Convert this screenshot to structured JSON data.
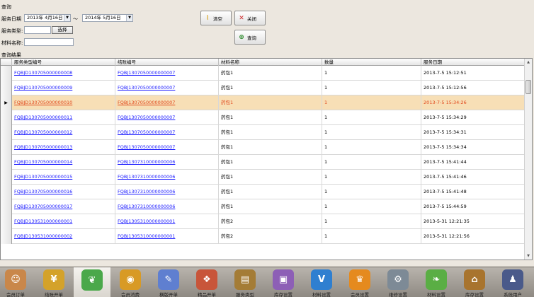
{
  "query": {
    "section_title": "查询",
    "date_label": "服务日期",
    "date_from": "2013年 4月16日",
    "date_sep": "～",
    "date_to": "2014年 5月16日",
    "service_type_label": "服务类型:",
    "service_type_value": "",
    "select_button": "选择",
    "material_label": "材料名称:",
    "material_value": "",
    "clear_button": "清空",
    "close_button": "关闭",
    "search_button": "查询"
  },
  "results": {
    "section_title": "查询结果",
    "columns": [
      "服务类型编号",
      "结账编号",
      "材料名称",
      "数量",
      "服务日期"
    ],
    "rows": [
      {
        "type_no": "FQBJD130705000000008",
        "settle_no": "FQBJ1307050000000007",
        "material": "药包1",
        "qty": "1",
        "date": "2013-7-5 15:12:51"
      },
      {
        "type_no": "FQBJD130705000000009",
        "settle_no": "FQBJ1307050000000007",
        "material": "药包1",
        "qty": "1",
        "date": "2013-7-5 15:12:56"
      },
      {
        "type_no": "FQBJD130705000000010",
        "settle_no": "FQBJ1307050000000007",
        "material": "药包1",
        "qty": "1",
        "date": "2013-7-5 15:34:26"
      },
      {
        "type_no": "FQBJD130705000000011",
        "settle_no": "FQBJ1307050000000007",
        "material": "药包1",
        "qty": "1",
        "date": "2013-7-5 15:34:29"
      },
      {
        "type_no": "FQBJD130705000000012",
        "settle_no": "FQBJ1307050000000007",
        "material": "药包1",
        "qty": "1",
        "date": "2013-7-5 15:34:31"
      },
      {
        "type_no": "FQBJD130705000000013",
        "settle_no": "FQBJ1307050000000007",
        "material": "药包1",
        "qty": "1",
        "date": "2013-7-5 15:34:34"
      },
      {
        "type_no": "FQBJD130705000000014",
        "settle_no": "FQBJ1307310000000006",
        "material": "药包1",
        "qty": "1",
        "date": "2013-7-5 15:41:44"
      },
      {
        "type_no": "FQBJD130705000000015",
        "settle_no": "FQBJ1307310000000006",
        "material": "药包1",
        "qty": "1",
        "date": "2013-7-5 15:41:46"
      },
      {
        "type_no": "FQBJD130705000000016",
        "settle_no": "FQBJ1307310000000006",
        "material": "药包1",
        "qty": "1",
        "date": "2013-7-5 15:41:48"
      },
      {
        "type_no": "FQBJD130705000000017",
        "settle_no": "FQBJ1307310000000006",
        "material": "药包1",
        "qty": "1",
        "date": "2013-7-5 15:44:59"
      },
      {
        "type_no": "FQBJD130531000000001",
        "settle_no": "FQBJ1305310000000001",
        "material": "药包2",
        "qty": "1",
        "date": "2013-5-31 12:21:35"
      },
      {
        "type_no": "FQBJD130531000000002",
        "settle_no": "FQBJ1305310000000001",
        "material": "药包2",
        "qty": "1",
        "date": "2013-5-31 12:21:56"
      }
    ],
    "selected_index": 2,
    "current_row_marker": "▶"
  },
  "dock": {
    "items": [
      {
        "label": "会员订单",
        "icon": "person-icon",
        "color": "#c9874a"
      },
      {
        "label": "结账开单",
        "icon": "money-icon",
        "color": "#d4a22a"
      },
      {
        "label": "",
        "icon": "leaf-money-icon",
        "color": "#4aa84a"
      },
      {
        "label": "会员消费",
        "icon": "coins-icon",
        "color": "#d89a25"
      },
      {
        "label": "横版开单",
        "icon": "pen-icon",
        "color": "#5f7fd0"
      },
      {
        "label": "精品开单",
        "icon": "gift-icon",
        "color": "#c8553a"
      },
      {
        "label": "服务类型",
        "icon": "document-icon",
        "color": "#a47c36"
      },
      {
        "label": "库存设置",
        "icon": "box-icon",
        "color": "#8d5fb6"
      },
      {
        "label": "材料设置",
        "icon": "sale-vip-icon",
        "color": "#2f7fd0"
      },
      {
        "label": "会员设置",
        "icon": "vip-icon",
        "color": "#e58a1e"
      },
      {
        "label": "维修设置",
        "icon": "gear-icon",
        "color": "#7d8a96"
      },
      {
        "label": "材料设置",
        "icon": "leaf-icon",
        "color": "#5aae44"
      },
      {
        "label": "库存设置",
        "icon": "warehouse-icon",
        "color": "#a8742e"
      },
      {
        "label": "系统用户",
        "icon": "user-icon",
        "color": "#4a5a8a"
      }
    ],
    "active_index": 2
  }
}
